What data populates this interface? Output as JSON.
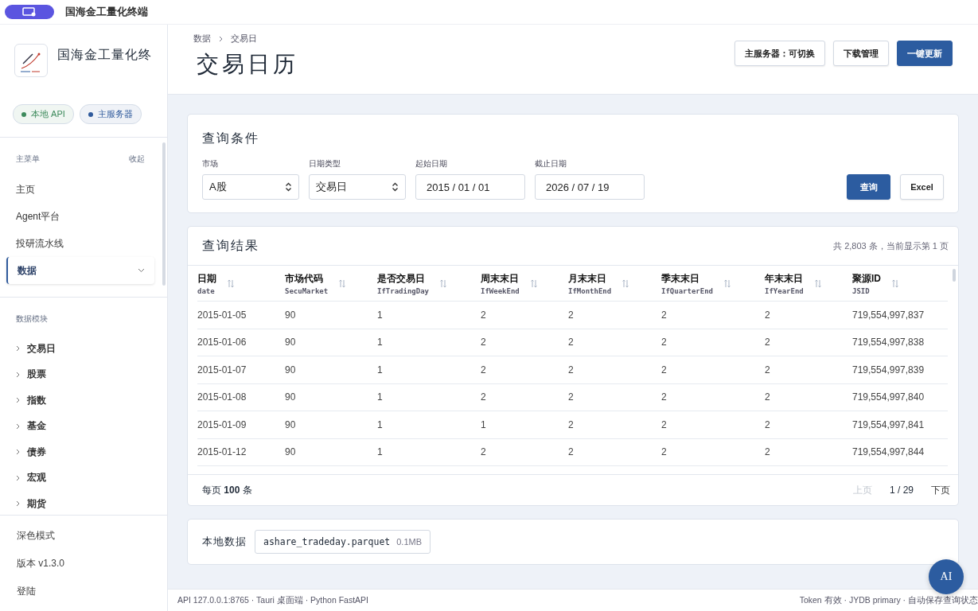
{
  "app_bar": {
    "title": "国海金工量化终端"
  },
  "sidebar": {
    "brand": "国海金工量化终",
    "status_chips": [
      {
        "label": "本地 API",
        "color": "#3d8a5c"
      },
      {
        "label": "主服务器",
        "color": "#2f5a9c"
      }
    ],
    "menu_title": "主菜单",
    "collapse": "收起",
    "menu": [
      {
        "label": "主页",
        "selected": false,
        "expanded": false
      },
      {
        "label": "Agent平台",
        "selected": false,
        "expanded": false
      },
      {
        "label": "投研流水线",
        "selected": false,
        "expanded": false
      },
      {
        "label": "数据",
        "selected": true,
        "expanded": true
      }
    ],
    "modules_title": "数据模块",
    "modules": [
      "交易日",
      "股票",
      "指数",
      "基金",
      "债券",
      "宏观",
      "期货"
    ],
    "footer_items": [
      "深色模式",
      "版本 v1.3.0",
      "登陆"
    ]
  },
  "header": {
    "breadcrumb": [
      "数据",
      "交易日"
    ],
    "title": "交易日历",
    "buttons": [
      {
        "label": "主服务器：可切换",
        "kind": "outline"
      },
      {
        "label": "下载管理",
        "kind": "outline"
      },
      {
        "label": "一键更新",
        "kind": "primary"
      }
    ]
  },
  "query": {
    "title": "查询条件",
    "fields": [
      {
        "label": "市场",
        "kind": "select",
        "value": "A股"
      },
      {
        "label": "日期类型",
        "kind": "select",
        "value": "交易日"
      },
      {
        "label": "起始日期",
        "kind": "date",
        "value": "2015 / 01 / 01"
      },
      {
        "label": "截止日期",
        "kind": "date",
        "value": "2026 / 07 / 19"
      }
    ],
    "buttons": [
      {
        "label": "查询",
        "kind": "primary"
      },
      {
        "label": "Excel",
        "kind": "outline"
      }
    ]
  },
  "results": {
    "title": "查询结果",
    "summary": "共 2,803 条，当前显示第 1 页",
    "columns": [
      {
        "label": "日期",
        "key": "date"
      },
      {
        "label": "市场代码",
        "key": "SecuMarket"
      },
      {
        "label": "是否交易日",
        "key": "IfTradingDay"
      },
      {
        "label": "周末末日",
        "key": "IfWeekEnd"
      },
      {
        "label": "月末末日",
        "key": "IfMonthEnd"
      },
      {
        "label": "季末末日",
        "key": "IfQuarterEnd"
      },
      {
        "label": "年末末日",
        "key": "IfYearEnd"
      },
      {
        "label": "聚源ID",
        "key": "JSID"
      }
    ],
    "rows": [
      [
        "2015-01-05",
        "90",
        "1",
        "2",
        "2",
        "2",
        "2",
        "719,554,997,837"
      ],
      [
        "2015-01-06",
        "90",
        "1",
        "2",
        "2",
        "2",
        "2",
        "719,554,997,838"
      ],
      [
        "2015-01-07",
        "90",
        "1",
        "2",
        "2",
        "2",
        "2",
        "719,554,997,839"
      ],
      [
        "2015-01-08",
        "90",
        "1",
        "2",
        "2",
        "2",
        "2",
        "719,554,997,840"
      ],
      [
        "2015-01-09",
        "90",
        "1",
        "1",
        "2",
        "2",
        "2",
        "719,554,997,841"
      ],
      [
        "2015-01-12",
        "90",
        "1",
        "2",
        "2",
        "2",
        "2",
        "719,554,997,844"
      ]
    ],
    "page_size": "每页 **100** 条",
    "prev": {
      "label": "上页",
      "disabled": true
    },
    "page": "1 / 29",
    "next": {
      "label": "下页",
      "disabled": false
    }
  },
  "local_data": {
    "label": "本地数据",
    "file": "ashare_tradeday.parquet",
    "size": "0.1MB"
  },
  "ai_button": "AI",
  "status_bar": {
    "left": "API 127.0.0.1:8765 · Tauri 桌面端 · Python FastAPI",
    "right": "Token 有效 · JYDB primary · 自动保存查询状态"
  }
}
